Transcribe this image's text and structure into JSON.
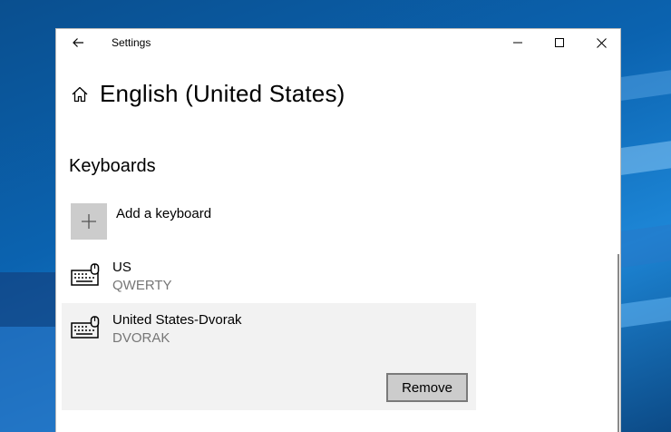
{
  "window": {
    "title": "Settings"
  },
  "page": {
    "title": "English (United States)"
  },
  "keyboards": {
    "heading": "Keyboards",
    "add_label": "Add a keyboard",
    "items": [
      {
        "name": "US",
        "layout": "QWERTY"
      },
      {
        "name": "United States-Dvorak",
        "layout": "DVORAK",
        "selected": true
      }
    ],
    "remove_label": "Remove"
  },
  "colors": {
    "accent_tile": "#cccccc",
    "selected_bg": "#f2f2f2",
    "secondary_text": "#767676"
  }
}
